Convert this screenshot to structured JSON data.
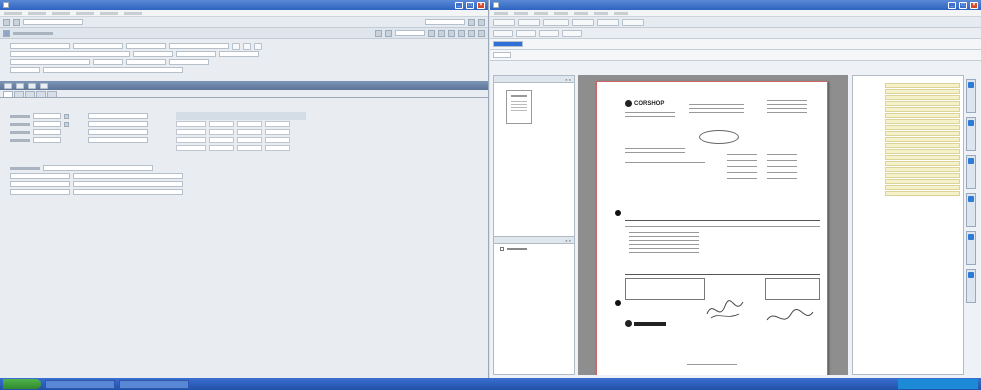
{
  "left_window": {
    "title": "",
    "tabs": [
      "",
      "",
      "",
      "",
      ""
    ],
    "sections": [
      "",
      "",
      "",
      ""
    ]
  },
  "right_window": {
    "title": "",
    "side_panel_title": "",
    "logo_text": "CORSHOP",
    "side_fields": [
      "",
      "",
      "",
      "",
      "",
      "",
      "",
      "",
      "",
      "",
      "",
      "",
      "",
      "",
      "",
      "",
      "",
      "",
      ""
    ]
  },
  "taskbar": {
    "start_label": "",
    "tasks": [
      "",
      ""
    ],
    "clock": ""
  },
  "colors": {
    "titlebar": "#2e63c0",
    "section_header": "#5b7498",
    "taskbar": "#2250a8",
    "start": "#2f8a2c",
    "field_highlight": "#f5f1c9"
  }
}
